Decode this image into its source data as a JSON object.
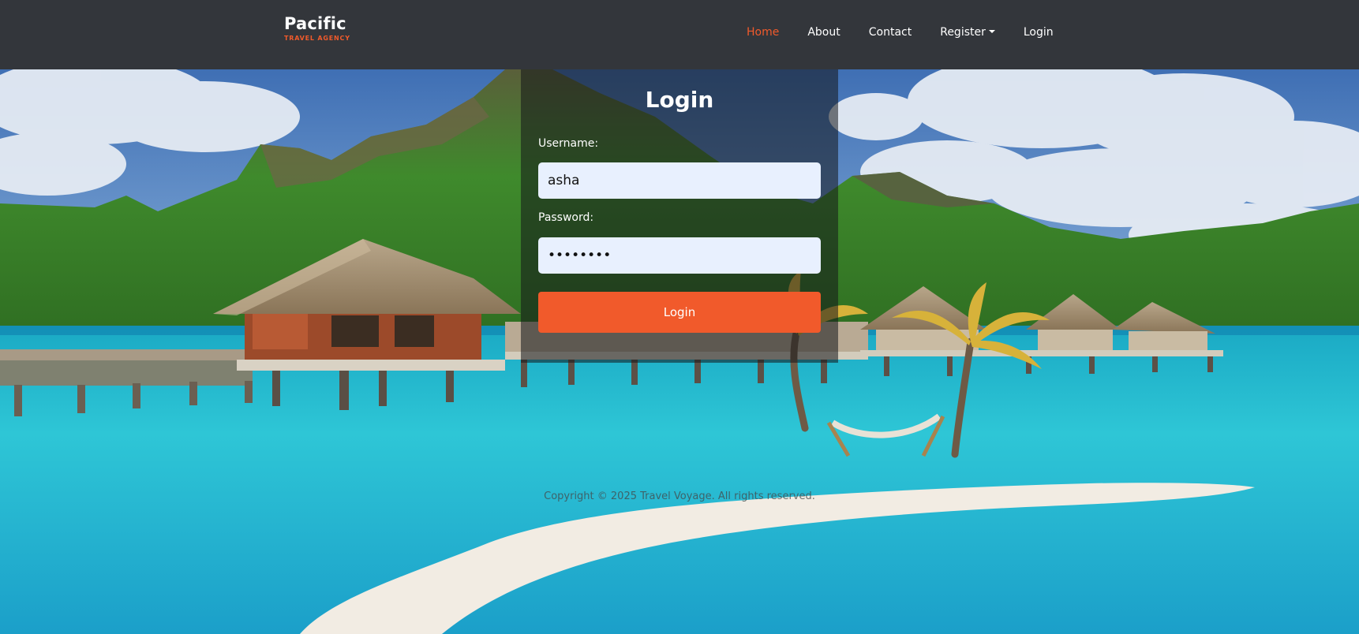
{
  "brand": {
    "name": "Pacific",
    "tagline": "TRAVEL AGENCY",
    "accent_color": "#f15a2b"
  },
  "nav": {
    "items": [
      {
        "label": "Home",
        "active": true
      },
      {
        "label": "About",
        "active": false
      },
      {
        "label": "Contact",
        "active": false
      },
      {
        "label": "Register",
        "active": false,
        "dropdown": true
      },
      {
        "label": "Login",
        "active": false
      }
    ]
  },
  "login": {
    "title": "Login",
    "username_label": "Username:",
    "username_value": "asha",
    "password_label": "Password:",
    "password_value": "••••••••",
    "submit_label": "Login"
  },
  "footer": {
    "text": "Copyright © 2025 Travel Voyage. All rights reserved."
  },
  "background": {
    "icon": "tropical-resort-scene"
  }
}
